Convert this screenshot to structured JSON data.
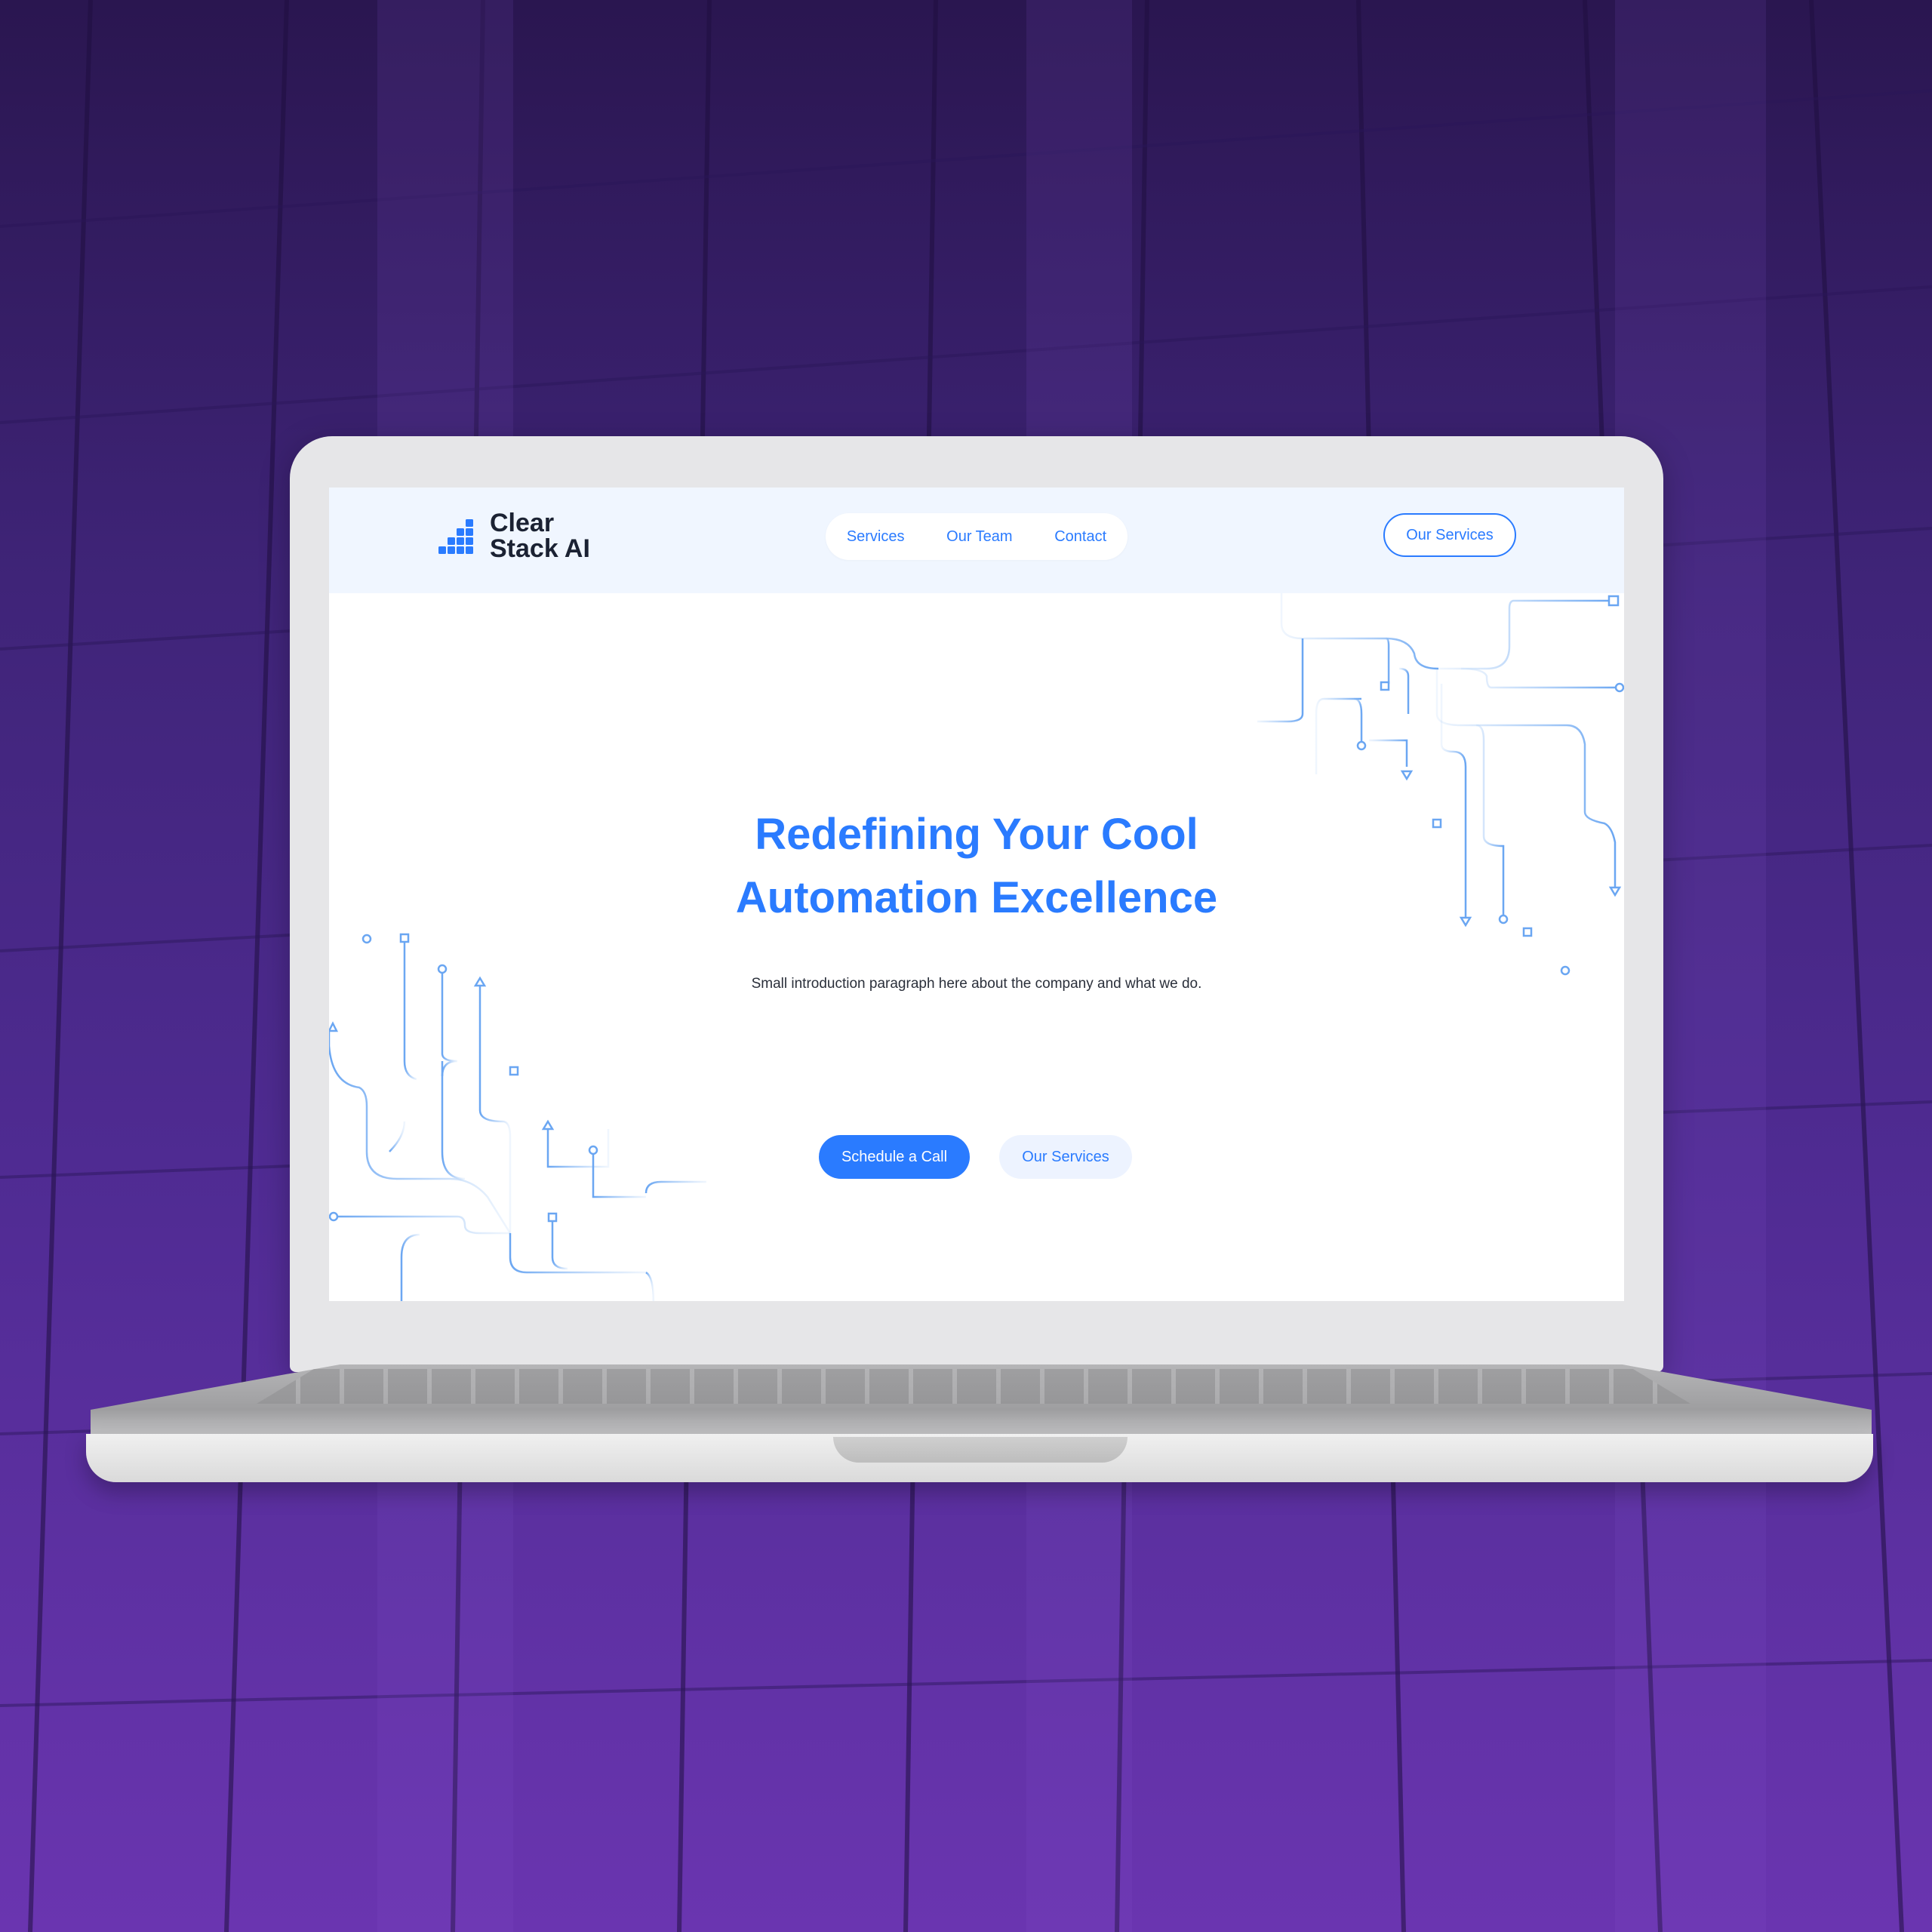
{
  "brand": {
    "name_line1": "Clear",
    "name_line2": "Stack AI",
    "logo_icon": "bar-stack-logo-icon"
  },
  "nav": {
    "items": [
      {
        "label": "Services"
      },
      {
        "label": "Our Team"
      },
      {
        "label": "Contact"
      }
    ],
    "cta_label": "Our Services"
  },
  "hero": {
    "title_line1": "Redefining Your Cool",
    "title_line2": "Automation Excellence",
    "subtitle": "Small introduction paragraph here about the company and what we do.",
    "primary_cta": "Schedule a Call",
    "secondary_cta": "Our Services"
  },
  "colors": {
    "accent": "#2a7bff",
    "header_bg": "#f0f6ff",
    "text_dark": "#1b2233",
    "background_purple": "#4f2b92",
    "circuit_lines": "#9cc4f5"
  }
}
